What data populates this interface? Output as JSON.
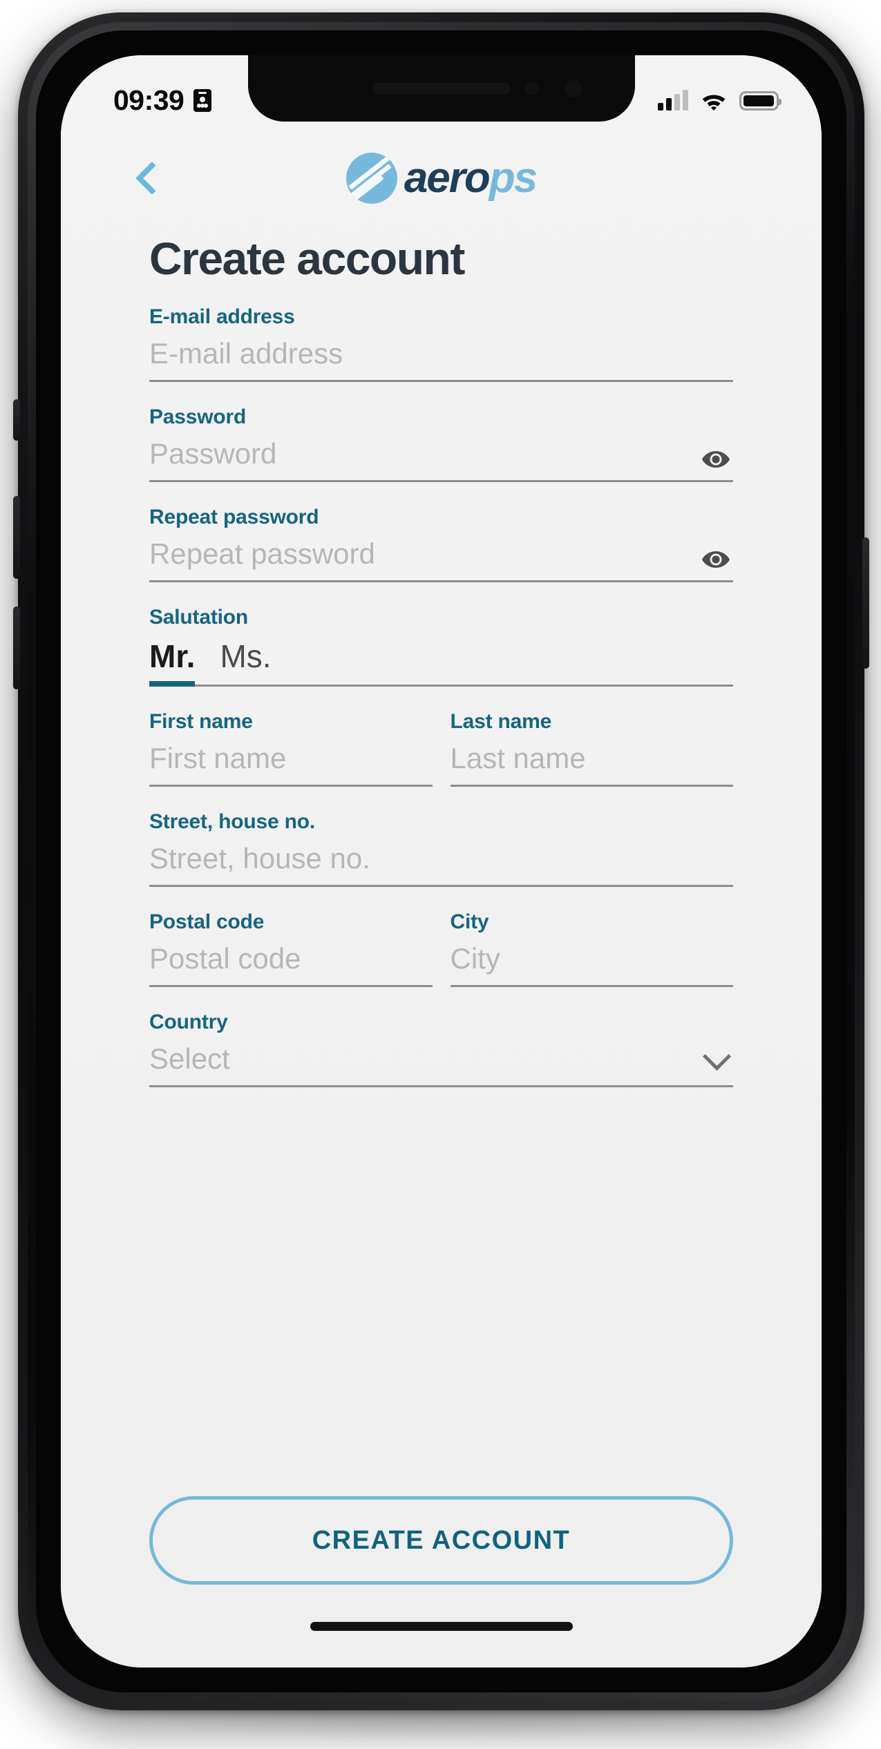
{
  "statusbar": {
    "time": "09:39",
    "idcard_icon": "id-card-icon",
    "signal_icon": "cellular-signal-icon",
    "wifi_icon": "wifi-icon",
    "battery_icon": "battery-icon"
  },
  "appbar": {
    "back_icon": "chevron-left-icon",
    "brand_mark": "aerops-circle-logo-icon",
    "brand_part1": "aero",
    "brand_part2": "ps"
  },
  "page": {
    "title": "Create account"
  },
  "form": {
    "email": {
      "label": "E-mail address",
      "placeholder": "E-mail address",
      "value": ""
    },
    "password": {
      "label": "Password",
      "placeholder": "Password",
      "value": "",
      "toggle_icon": "eye-icon"
    },
    "repeat_password": {
      "label": "Repeat password",
      "placeholder": "Repeat password",
      "value": "",
      "toggle_icon": "eye-icon"
    },
    "salutation": {
      "label": "Salutation",
      "options": [
        "Mr.",
        "Ms."
      ],
      "selected": "Mr."
    },
    "first_name": {
      "label": "First name",
      "placeholder": "First name",
      "value": ""
    },
    "last_name": {
      "label": "Last name",
      "placeholder": "Last name",
      "value": ""
    },
    "street": {
      "label": "Street, house no.",
      "placeholder": "Street, house no.",
      "value": ""
    },
    "postal_code": {
      "label": "Postal code",
      "placeholder": "Postal code",
      "value": ""
    },
    "city": {
      "label": "City",
      "placeholder": "City",
      "value": ""
    },
    "country": {
      "label": "Country",
      "placeholder": "Select",
      "value": "",
      "dropdown_icon": "chevron-down-icon"
    }
  },
  "cta": {
    "label": "CREATE ACCOUNT"
  },
  "colors": {
    "label_teal": "#156582",
    "accent_light_blue": "#74b8dc",
    "title_dark": "#2b3640",
    "placeholder_gray": "#b6b6b6",
    "underline_gray": "#8d8d8d",
    "screen_bg": "#f1f1f1"
  }
}
